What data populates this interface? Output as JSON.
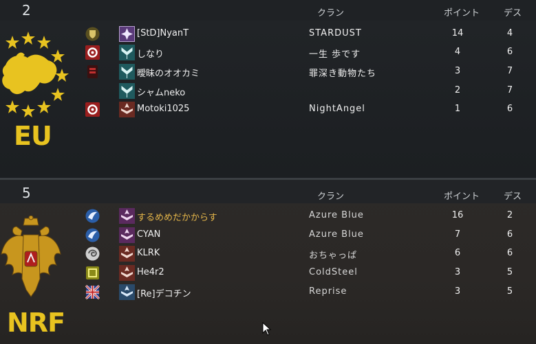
{
  "columns": {
    "clan": "クラン",
    "points": "ポイント",
    "deaths": "デス"
  },
  "teams": [
    {
      "tag": "EU",
      "score": "2",
      "players": [
        {
          "name": "[StD]NyanT",
          "clan": "STARDUST",
          "points": "14",
          "deaths": "4",
          "badge": "shield-gold-badge-icon",
          "rank": "rank-purple-icon"
        },
        {
          "name": "しなり",
          "clan": "一生 歩です",
          "points": "4",
          "deaths": "6",
          "badge": "red-circle-badge-icon",
          "rank": "rank-teal-icon"
        },
        {
          "name": "曖昧のオオカミ",
          "clan": "罪深き動物たち",
          "points": "3",
          "deaths": "7",
          "badge": "dark-red-badge-icon",
          "rank": "rank-teal-icon"
        },
        {
          "name": "シャムneko",
          "clan": "",
          "points": "2",
          "deaths": "7",
          "badge": "",
          "rank": "rank-teal-icon"
        },
        {
          "name": "Motoki1025",
          "clan": "NightAngel",
          "points": "1",
          "deaths": "6",
          "badge": "red-circle-badge-icon",
          "rank": "rank-red-icon"
        }
      ]
    },
    {
      "tag": "NRF",
      "score": "5",
      "players": [
        {
          "name": "するめめだかからす",
          "clan": "Azure Blue",
          "points": "16",
          "deaths": "2",
          "badge": "blue-wings-badge-icon",
          "rank": "rank-purple-icon",
          "highlight": true
        },
        {
          "name": "CYAN",
          "clan": "Azure Blue",
          "points": "7",
          "deaths": "6",
          "badge": "blue-wings-badge-icon",
          "rank": "rank-purple-icon"
        },
        {
          "name": "KLRK",
          "clan": "おちゃっぱ",
          "points": "6",
          "deaths": "6",
          "badge": "white-swirl-badge-icon",
          "rank": "rank-red-icon"
        },
        {
          "name": "He4r2",
          "clan": "ColdSteel",
          "points": "3",
          "deaths": "5",
          "badge": "gold-square-badge-icon",
          "rank": "rank-red-icon"
        },
        {
          "name": "[Re]デコチン",
          "clan": "Reprise",
          "points": "3",
          "deaths": "5",
          "badge": "union-flag-badge-icon",
          "rank": "rank-blue-icon"
        }
      ]
    }
  ],
  "colors": {
    "tag": "#e8c320",
    "highlight_name": "#e8b84a",
    "eu_flag_star": "#e8c320"
  }
}
